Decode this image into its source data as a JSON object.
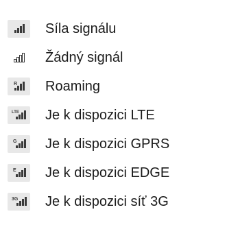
{
  "colors": {
    "icon_bg": "#e8e8e8",
    "icon_fg": "#3a3a3a",
    "text": "#1a1a1a"
  },
  "items": [
    {
      "icon": "signal-strength-icon",
      "label": "Síla signálu"
    },
    {
      "icon": "no-signal-icon",
      "label": "Žádný signál"
    },
    {
      "icon": "roaming-icon",
      "label": "Roaming",
      "badge": "R"
    },
    {
      "icon": "lte-icon",
      "label": "Je k dispozici LTE",
      "badge": "LTE"
    },
    {
      "icon": "gprs-icon",
      "label": "Je k dispozici GPRS",
      "badge": "G"
    },
    {
      "icon": "edge-icon",
      "label": "Je k dispozici EDGE",
      "badge": "E"
    },
    {
      "icon": "3g-icon",
      "label": "Je k dispozici síť 3G",
      "badge": "3G"
    }
  ]
}
